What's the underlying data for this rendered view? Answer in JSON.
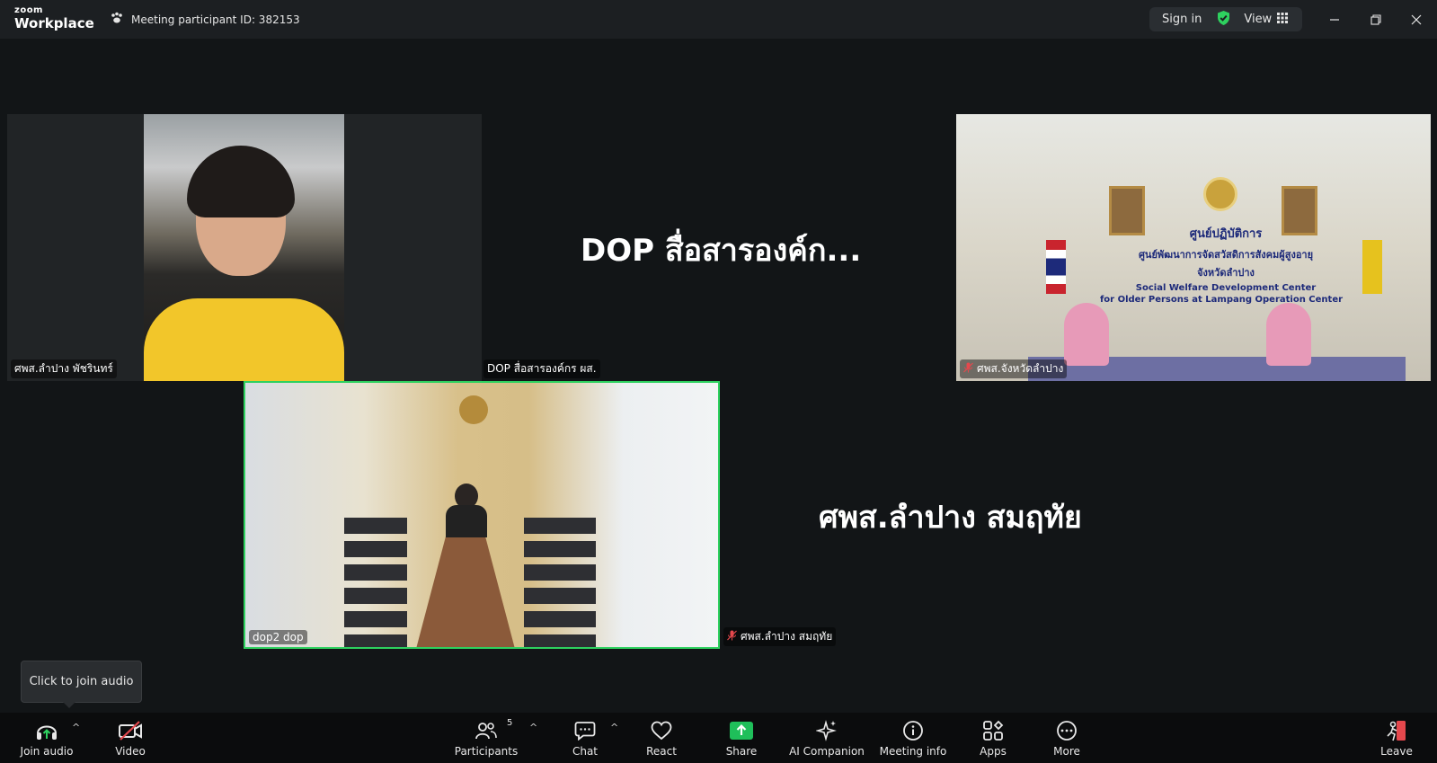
{
  "app": {
    "brand_small": "zoom",
    "brand_big": "Workplace",
    "meeting_id_text": "Meeting participant ID: 382153",
    "signin_label": "Sign in",
    "view_label": "View"
  },
  "colors": {
    "accent_green": "#2ed15f",
    "muted_red": "#e5484d",
    "share_green": "#1fbf5a",
    "background": "#121517"
  },
  "tiles": {
    "tile1_label": "ศพส.ลำปาง พัชรินทร์",
    "tile2_label": "DOP สื่อสารองค์กร ผส.",
    "tile2_bigname": "DOP สื่อสารองค์ก...",
    "tile3_label": "ศพส.จังหวัดลำปาง",
    "tile3_sign_line1": "ศูนย์ปฏิบัติการ",
    "tile3_sign_line2": "ศูนย์พัฒนาการจัดสวัสดิการสังคมผู้สูงอายุ",
    "tile3_sign_line3": "จังหวัดลำปาง",
    "tile3_sign_line4": "Social Welfare Development Center",
    "tile3_sign_line5": "for Older Persons at Lampang Operation Center",
    "tile4_label": "dop2 dop",
    "tile5_label": "ศพส.ลำปาง สมฤทัย",
    "tile5_bigname": "ศพส.ลำปาง สมฤทัย"
  },
  "tooltip": {
    "text": "Click to join audio"
  },
  "toolbar": {
    "join_audio": "Join audio",
    "video": "Video",
    "participants": "Participants",
    "participants_count": "5",
    "chat": "Chat",
    "react": "React",
    "share": "Share",
    "ai_companion": "AI Companion",
    "meeting_info": "Meeting info",
    "apps": "Apps",
    "more": "More",
    "leave": "Leave"
  },
  "icons": {
    "meeting_id_icon": "paw-icon",
    "shield": "shield-check-icon",
    "view": "grid-icon"
  }
}
